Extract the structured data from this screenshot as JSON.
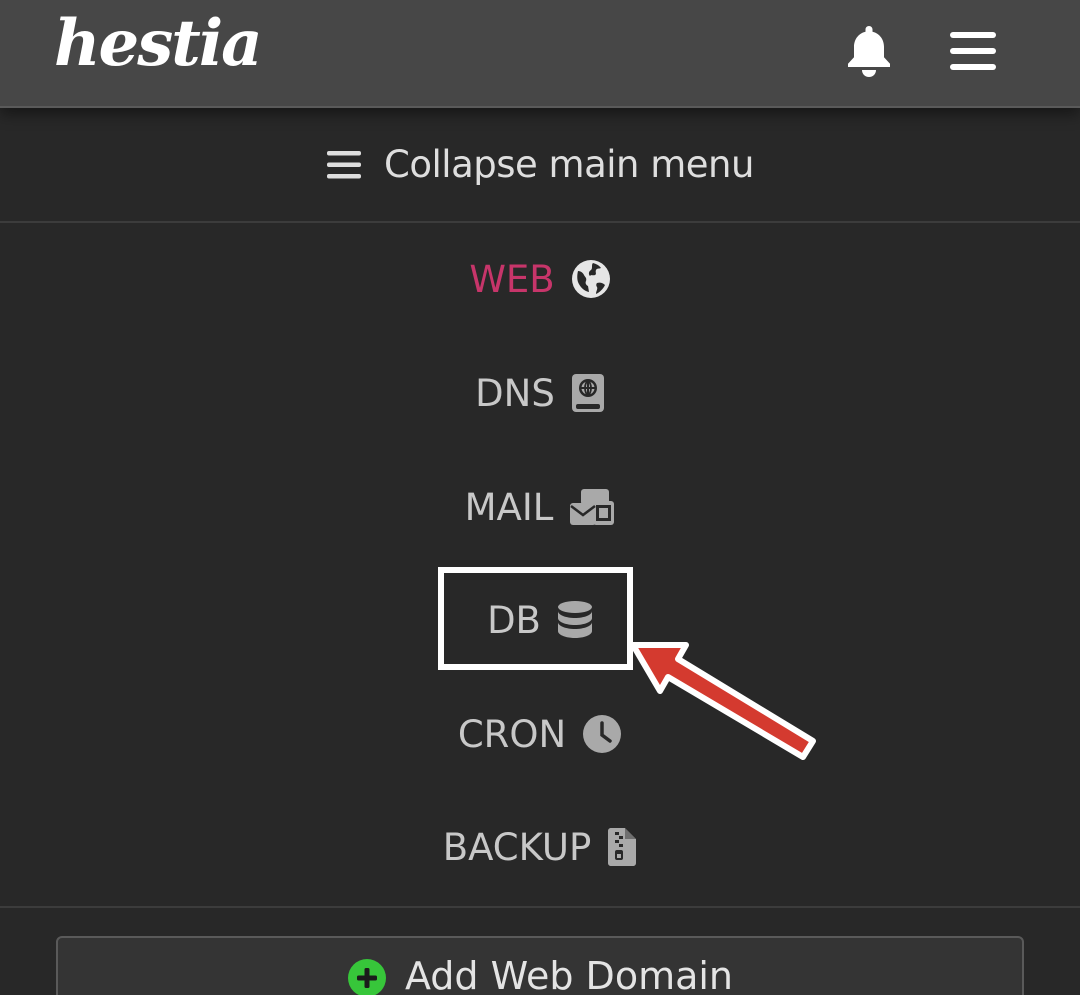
{
  "app": {
    "logo_text": "hestia"
  },
  "header": {
    "notifications_icon": "bell-icon",
    "menu_icon": "hamburger-icon"
  },
  "collapse": {
    "label": "Collapse main menu",
    "icon": "hamburger-icon"
  },
  "menu": {
    "items": [
      {
        "label": "WEB",
        "icon": "globe-icon",
        "active": true
      },
      {
        "label": "DNS",
        "icon": "atlas-book-icon",
        "active": false
      },
      {
        "label": "MAIL",
        "icon": "mail-bulk-icon",
        "active": false
      },
      {
        "label": "DB",
        "icon": "database-icon",
        "active": false
      },
      {
        "label": "CRON",
        "icon": "clock-icon",
        "active": false
      },
      {
        "label": "BACKUP",
        "icon": "file-zipper-icon",
        "active": false
      }
    ]
  },
  "action": {
    "add_label": "Add Web Domain",
    "icon": "plus-circle-icon"
  },
  "colors": {
    "active": "#c7356a",
    "accent_green": "#37c63a",
    "annotation_red": "#d43a2f"
  }
}
